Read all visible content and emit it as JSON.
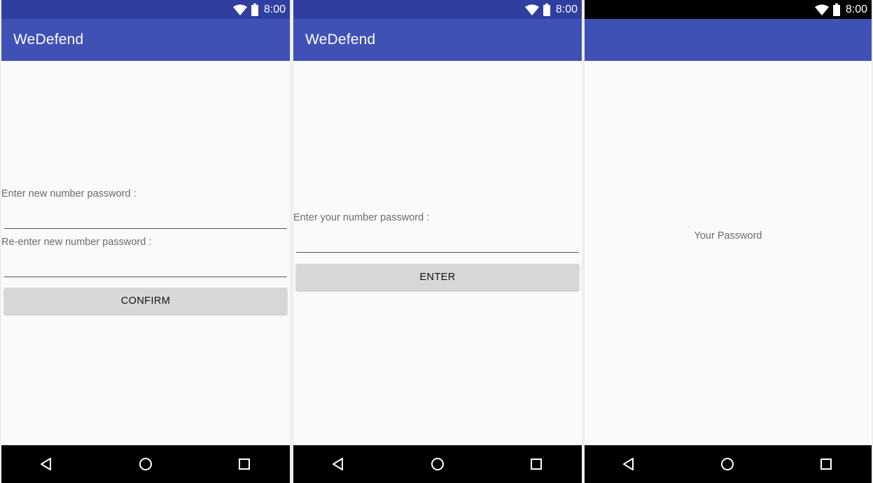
{
  "status_bar": {
    "time": "8:00"
  },
  "screen1": {
    "app_title": "WeDefend",
    "new_password_label": "Enter new number password :",
    "new_password_value": "",
    "reenter_password_label": "Re-enter new number password :",
    "reenter_password_value": "",
    "confirm_label": "CONFIRM"
  },
  "screen2": {
    "app_title": "WeDefend",
    "password_label": "Enter your number password :",
    "password_value": "",
    "enter_label": "ENTER"
  },
  "screen3": {
    "app_title": "",
    "password_text": "Your Password"
  },
  "nav": {
    "back_icon": "back-triangle-icon",
    "home_icon": "home-circle-icon",
    "recents_icon": "recents-square-icon"
  },
  "colors": {
    "status_bar": "#303f9f",
    "app_bar": "#3f51b5",
    "button": "#d6d7d7",
    "background": "#fafafa"
  }
}
